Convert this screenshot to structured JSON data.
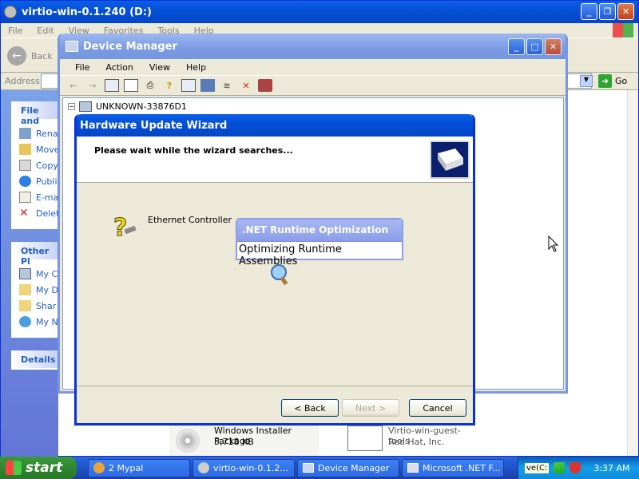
{
  "explorer": {
    "title": "virtio-win-0.1.240 (D:)",
    "menu": [
      "File",
      "Edit",
      "View",
      "Favorites",
      "Tools",
      "Help"
    ],
    "back_label": "Back",
    "address_label": "Address",
    "go_label": "Go",
    "file_tasks": {
      "heading": "File and",
      "items": [
        {
          "label": "Rena",
          "icon": "rename-icon"
        },
        {
          "label": "Move",
          "icon": "move-icon"
        },
        {
          "label": "Copy",
          "icon": "copy-icon"
        },
        {
          "label": "Publi",
          "icon": "publish-icon"
        },
        {
          "label": "E-ma",
          "icon": "email-icon"
        },
        {
          "label": "Delet",
          "icon": "delete-icon"
        }
      ]
    },
    "other_places": {
      "heading": "Other Pl",
      "items": [
        {
          "label": "My C",
          "icon": "my-computer-icon"
        },
        {
          "label": "My D",
          "icon": "my-documents-icon"
        },
        {
          "label": "Shar",
          "icon": "shared-icon"
        },
        {
          "label": "My N",
          "icon": "my-network-icon"
        }
      ]
    },
    "details_heading": "Details",
    "files": [
      {
        "name": "Windows Installer Package",
        "meta": "5,718 KB"
      },
      {
        "name": "Virtio-win-guest-tools",
        "meta": "Red Hat, Inc."
      }
    ]
  },
  "devmgr": {
    "title": "Device Manager",
    "menu": [
      "File",
      "Action",
      "View",
      "Help"
    ],
    "tree_root": "UNKNOWN-33876D1"
  },
  "wizard": {
    "title": "Hardware Update Wizard",
    "heading": "Please wait while the wizard searches...",
    "device": "Ethernet Controller",
    "back": "< Back",
    "next": "Next >",
    "cancel": "Cancel"
  },
  "net_popup": {
    "title": ".NET Runtime Optimization",
    "message": "Optimizing Runtime Assemblies"
  },
  "taskbar": {
    "start": "start",
    "tasks": [
      "2 Mypal",
      "virtio-win-0.1.2...",
      "Device Manager",
      "Microsoft .NET F..."
    ],
    "clock": "3:37 AM",
    "tray_text": "ve(C:"
  },
  "colors": {
    "xp_blue": "#0a5fe6",
    "start_green": "#318531",
    "link_blue": "#215dc6"
  }
}
